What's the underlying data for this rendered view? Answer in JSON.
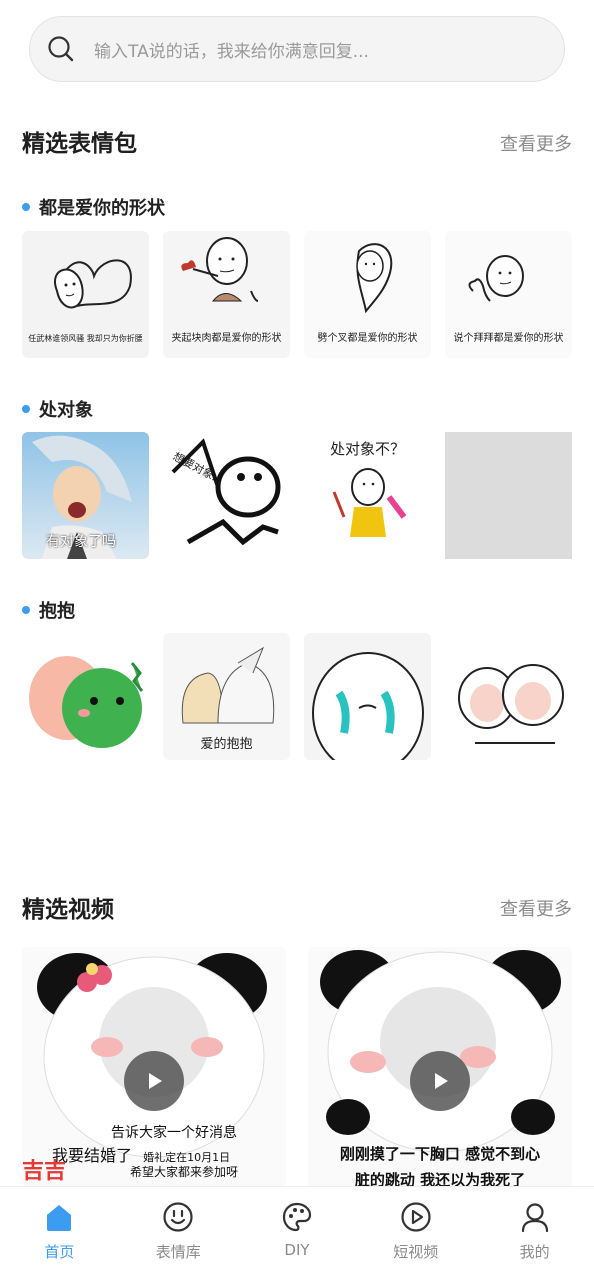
{
  "search": {
    "placeholder": "输入TA说的话，我来给你满意回复..."
  },
  "stickers": {
    "title": "精选表情包",
    "more": "查看更多",
    "categories": [
      {
        "name": "都是爱你的形状",
        "items": [
          {
            "caption": "任武林谁领风骚 我却只为你折腰"
          },
          {
            "caption": "夹起块肉都是爱你的形状"
          },
          {
            "caption": "劈个叉都是爱你的形状"
          },
          {
            "caption": "说个拜拜都是爱你的形状"
          }
        ]
      },
      {
        "name": "处对象",
        "items": [
          {
            "caption": "有对象了吗"
          },
          {
            "caption": "想要对象..."
          },
          {
            "caption": "处对象不？"
          },
          {
            "caption": ""
          }
        ]
      },
      {
        "name": "抱抱",
        "items": [
          {
            "caption": ""
          },
          {
            "caption": "爱的抱抱"
          },
          {
            "caption": ""
          },
          {
            "caption": ""
          }
        ]
      }
    ]
  },
  "videos": {
    "title": "精选视频",
    "more": "查看更多",
    "items": [
      {
        "line1": "告诉大家一个好消息",
        "line2a": "我要结婚了",
        "line2b": "婚礼定在10月1日",
        "line3": "希望大家都来参加呀",
        "corner": "吉吉"
      },
      {
        "line1": "刚刚摸了一下胸口   感觉不到心",
        "line2": "脏的跳动 我还以为我死了"
      }
    ]
  },
  "tabbar": {
    "active": "home",
    "tabs": [
      {
        "id": "home",
        "label": "首页",
        "icon": "home-icon"
      },
      {
        "id": "stickers",
        "label": "表情库",
        "icon": "smiley-icon"
      },
      {
        "id": "diy",
        "label": "DIY",
        "icon": "palette-icon"
      },
      {
        "id": "video",
        "label": "短视频",
        "icon": "play-circle-icon"
      },
      {
        "id": "me",
        "label": "我的",
        "icon": "user-icon"
      }
    ]
  },
  "colors": {
    "accent": "#3b9cf0",
    "muted": "#8a8a8a"
  }
}
